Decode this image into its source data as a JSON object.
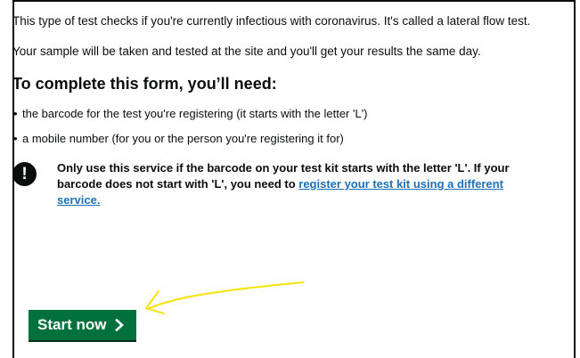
{
  "intro": {
    "line1": "This type of test checks if you're currently infectious with coronavirus. It's called a lateral flow test.",
    "line2": "Your sample will be taken and tested at the site and you'll get your results the same day."
  },
  "heading": "To complete this form, you’ll need:",
  "list": [
    "the barcode for the test you're registering (it starts with the letter 'L')",
    "a mobile number (for you or the person you're registering it for)"
  ],
  "warning": {
    "icon_text": "!",
    "text": "Only use this service if the barcode on your test kit starts with the letter 'L'. If your barcode does not start with 'L', you need to ",
    "link_text": "register your test kit using a different service."
  },
  "start_button": {
    "label": "Start now"
  },
  "colors": {
    "button_green": "#00703c",
    "link_blue": "#1d70b8",
    "annotation_yellow": "#f6e41c"
  }
}
